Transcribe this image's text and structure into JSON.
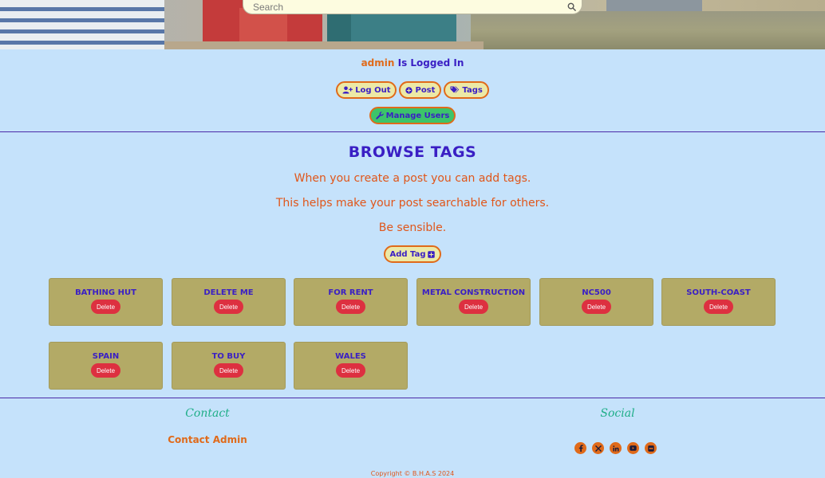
{
  "search": {
    "placeholder": "Search"
  },
  "session": {
    "username": "admin",
    "status_text": "Is Logged In"
  },
  "nav": {
    "logout_label": "Log Out",
    "post_label": "Post",
    "tags_label": "Tags",
    "manage_users_label": "Manage Users"
  },
  "browse": {
    "title": "BROWSE TAGS",
    "lines": [
      "When you create a post you can add tags.",
      "This helps make your post searchable for others.",
      "Be sensible."
    ],
    "add_tag_label": "Add Tag"
  },
  "tags": [
    {
      "name": "BATHING HUT",
      "delete_label": "Delete"
    },
    {
      "name": "DELETE ME",
      "delete_label": "Delete"
    },
    {
      "name": "FOR RENT",
      "delete_label": "Delete"
    },
    {
      "name": "METAL CONSTRUCTION",
      "delete_label": "Delete"
    },
    {
      "name": "NC500",
      "delete_label": "Delete"
    },
    {
      "name": "SOUTH-COAST",
      "delete_label": "Delete"
    },
    {
      "name": "SPAIN",
      "delete_label": "Delete"
    },
    {
      "name": "TO BUY",
      "delete_label": "Delete"
    },
    {
      "name": "WALES",
      "delete_label": "Delete"
    }
  ],
  "footer": {
    "contact_heading": "Contact",
    "contact_link": "Contact Admin",
    "social_heading": "Social",
    "social_icons": [
      "facebook-icon",
      "x-twitter-icon",
      "linkedin-icon",
      "youtube-icon",
      "flickr-icon"
    ],
    "copyright": "Copyright © B.H.A.S 2024"
  },
  "colors": {
    "background": "#c5e2fb",
    "accent_orange": "#e06a1a",
    "accent_purple": "#3a1fc4",
    "tag_card": "#b3aa66",
    "delete_red": "#dd3040",
    "button_yellow": "#ece9a6",
    "button_green": "#3cc46a",
    "footer_heading": "#1fae88"
  }
}
